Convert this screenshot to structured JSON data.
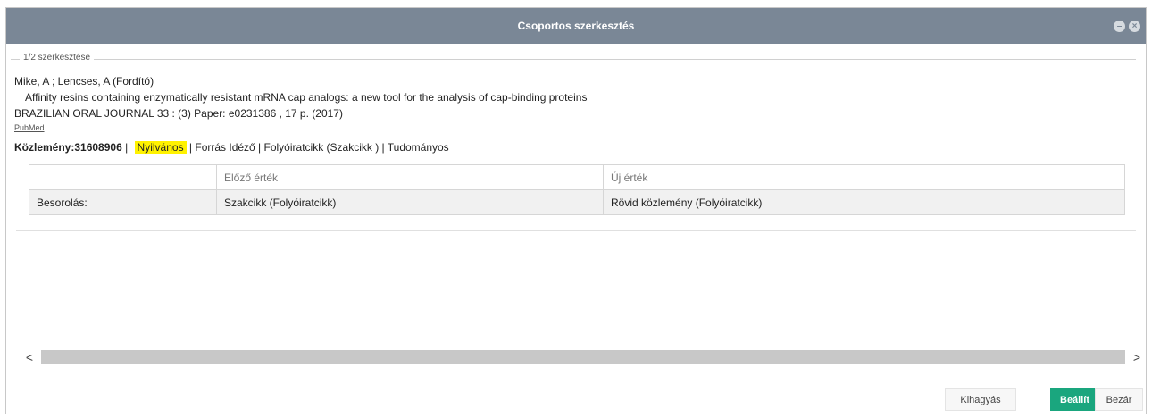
{
  "dialog": {
    "title": "Csoportos szerkesztés"
  },
  "section": {
    "legend": "1/2 szerkesztése",
    "authors": "Mike, A ; Lencses, A (Fordító)",
    "article_title": "Affinity resins containing enzymatically resistant mRNA cap analogs: a new tool for the analysis of cap-binding proteins",
    "journal": "BRAZILIAN ORAL JOURNAL 33 : (3) Paper: e0231386 , 17 p. (2017)",
    "pubmed_link": "PubMed",
    "publication_id": "Közlemény:31608906",
    "sep1": " | ",
    "visibility": "Nyilvános",
    "tail": " | Forrás Idéző | Folyóiratcikk (Szakcikk ) | Tudományos"
  },
  "table": {
    "headers": [
      "",
      "Előző érték",
      "Új érték"
    ],
    "rows": [
      [
        "Besorolás:",
        "Szakcikk (Folyóiratcikk)",
        "Rövid közlemény (Folyóiratcikk)"
      ]
    ]
  },
  "scrollbar": {
    "left_arrow": "<",
    "right_arrow": ">"
  },
  "buttons": {
    "skip": "Kihagyás",
    "apply": "Beállít",
    "close": "Bezár"
  },
  "icons": {
    "title_minimize": "circle-minus-icon",
    "title_close": "circle-close-icon"
  },
  "colors": {
    "titlebar": "#7a8796",
    "highlight": "#fff200",
    "apply_button": "#1aa67e"
  }
}
